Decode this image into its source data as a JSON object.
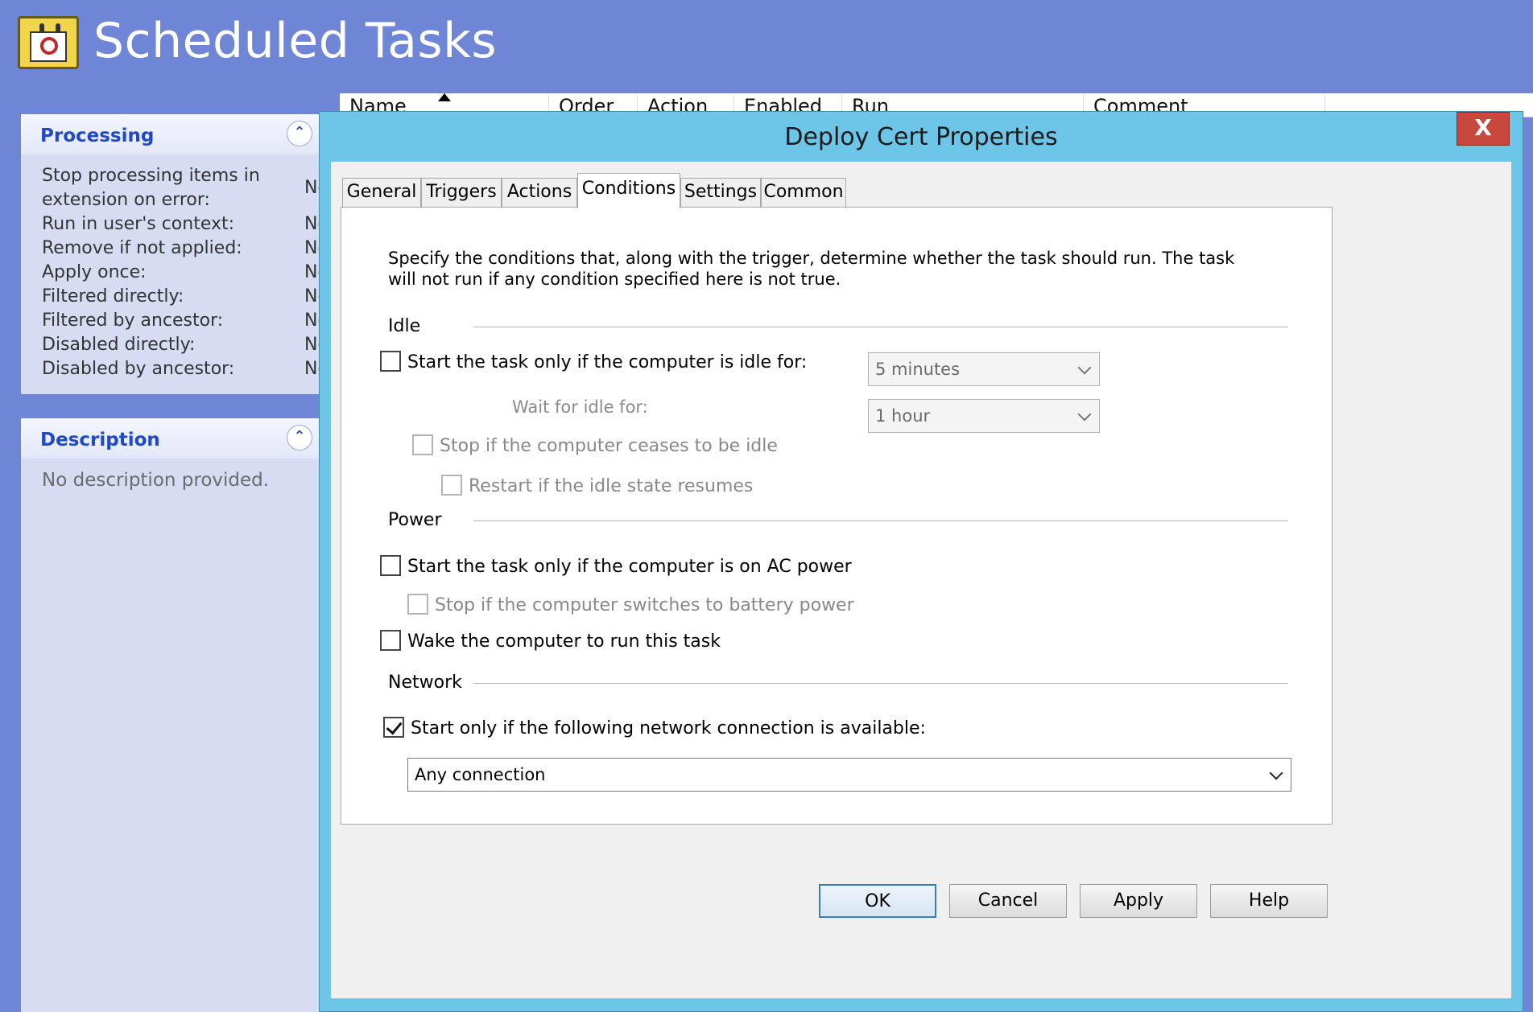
{
  "app": {
    "title": "Scheduled Tasks"
  },
  "columns": [
    "Name",
    "Order",
    "Action",
    "Enabled",
    "Run",
    "Comment"
  ],
  "processing_panel": {
    "title": "Processing",
    "rows": [
      {
        "label_line1": "Stop processing items in",
        "label_line2": "extension on error:",
        "value": "No"
      },
      {
        "label": "Run in user's context:",
        "value": "No"
      },
      {
        "label": "Remove if not applied:",
        "value": "No"
      },
      {
        "label": "Apply once:",
        "value": "No"
      },
      {
        "label": "Filtered directly:",
        "value": "No"
      },
      {
        "label": "Filtered by ancestor:",
        "value": "No"
      },
      {
        "label": "Disabled directly:",
        "value": "No"
      },
      {
        "label": "Disabled by ancestor:",
        "value": "No"
      }
    ]
  },
  "description_panel": {
    "title": "Description",
    "text": "No description provided."
  },
  "dialog": {
    "title": "Deploy Cert Properties",
    "close_label": "X",
    "tabs": [
      "General",
      "Triggers",
      "Actions",
      "Conditions",
      "Settings",
      "Common"
    ],
    "active_tab": "Conditions",
    "intro": "Specify the conditions that, along with the trigger, determine whether the task should run. The task will not run if any condition specified here is not true.",
    "idle": {
      "label": "Idle",
      "start_if_idle": {
        "label": "Start the task only if the computer is idle for:",
        "checked": false
      },
      "idle_for_value": "5 minutes",
      "wait_label": "Wait for idle for:",
      "wait_value": "1 hour",
      "stop_if_ceases": {
        "label": "Stop if the computer ceases to be idle",
        "checked": false
      },
      "restart_if_resumes": {
        "label": "Restart if the idle state resumes",
        "checked": false
      }
    },
    "power": {
      "label": "Power",
      "start_on_ac": {
        "label": "Start the task only if the computer is on AC power",
        "checked": false
      },
      "stop_on_battery": {
        "label": "Stop if the computer switches to battery power",
        "checked": false
      },
      "wake": {
        "label": "Wake the computer to run this task",
        "checked": false
      }
    },
    "network": {
      "label": "Network",
      "start_if_network": {
        "label": "Start only if the following network connection is available:",
        "checked": true
      },
      "connection_value": "Any connection"
    },
    "buttons": {
      "ok": "OK",
      "cancel": "Cancel",
      "apply": "Apply",
      "help": "Help"
    }
  }
}
